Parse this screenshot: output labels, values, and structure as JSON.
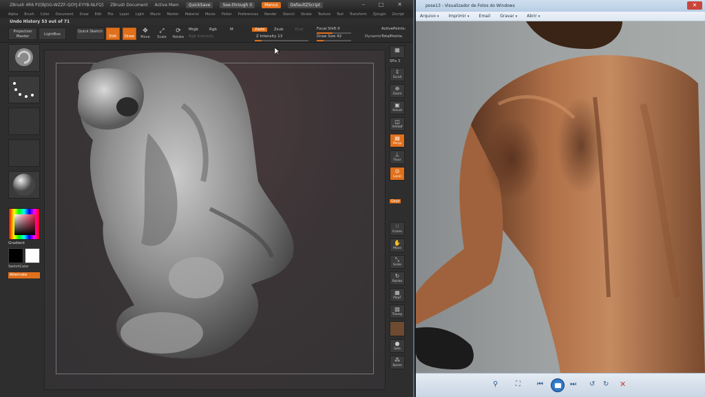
{
  "zbrush": {
    "title_items": [
      "ZBrush 4R6 P2[BJGG-WZZF-QOYJ-EYYB-NLFQ]",
      "ZBrush Document",
      "Active Mem"
    ],
    "quicksave": "QuickSave",
    "seethrough": "See-through  0",
    "menus_btn": "Menus",
    "default_script": "DefaultZScript",
    "menu_items": [
      "Alpha",
      "Brush",
      "Color",
      "Document",
      "Draw",
      "Edit",
      "File",
      "Layer",
      "Light",
      "Macro",
      "Marker",
      "Material",
      "Movie",
      "Picker",
      "Preferences",
      "Render",
      "Stencil",
      "Stroke",
      "Texture",
      "Tool",
      "Transform",
      "Zplugin",
      "Zscript"
    ],
    "undo_history": "Undo History 53 out of 71",
    "shelf": {
      "projection_master": "Projection Master",
      "lightbox": "LightBox",
      "quick_sketch": "Quick Sketch",
      "edit": "Edit",
      "draw": "Draw",
      "move": "Move",
      "scale": "Scale",
      "rotate": "Rotate",
      "mrgb": "Mrgb",
      "rgb": "Rgb",
      "m": "M",
      "zadd": "Zadd",
      "zsub": "Zsub",
      "zcut": "Zcut",
      "rgb_intensity": "Rgb Intensity",
      "z_intensity": "Z Intensity 13",
      "focal_shift": "Focal Shift 0",
      "draw_size": "Draw Size 42",
      "dynamic": "Dynamic",
      "active_points": "ActivePoints:",
      "total_points": "TotalPoints:"
    },
    "left_palette": {
      "gradient": "Gradient",
      "switch_color": "SwitchColor",
      "alternate": "Alternate"
    },
    "right_tray": [
      "SPix 3",
      "Scroll",
      "Zoom",
      "Actual",
      "AAHalf",
      "Persp",
      "Floor",
      "Local",
      "Gxyz",
      "Frame",
      "Move",
      "Scale",
      "Rotate",
      "PolyF",
      "Transp",
      "Solo",
      "Xpose"
    ],
    "colors": {
      "accent": "#e0701c",
      "panel": "#2e2e2e",
      "canvas": "#3a3436"
    }
  },
  "photo_viewer": {
    "title": "pose13 - Visualizador de Fotos do Windows",
    "menus": [
      "Arquivo",
      "Imprimir",
      "Email",
      "Gravar",
      "Abrir"
    ],
    "toolbar_icons": [
      "zoom-icon",
      "fit-icon",
      "previous-icon",
      "slideshow-icon",
      "next-icon",
      "rotate-ccw-icon",
      "rotate-cw-icon",
      "delete-icon"
    ]
  }
}
